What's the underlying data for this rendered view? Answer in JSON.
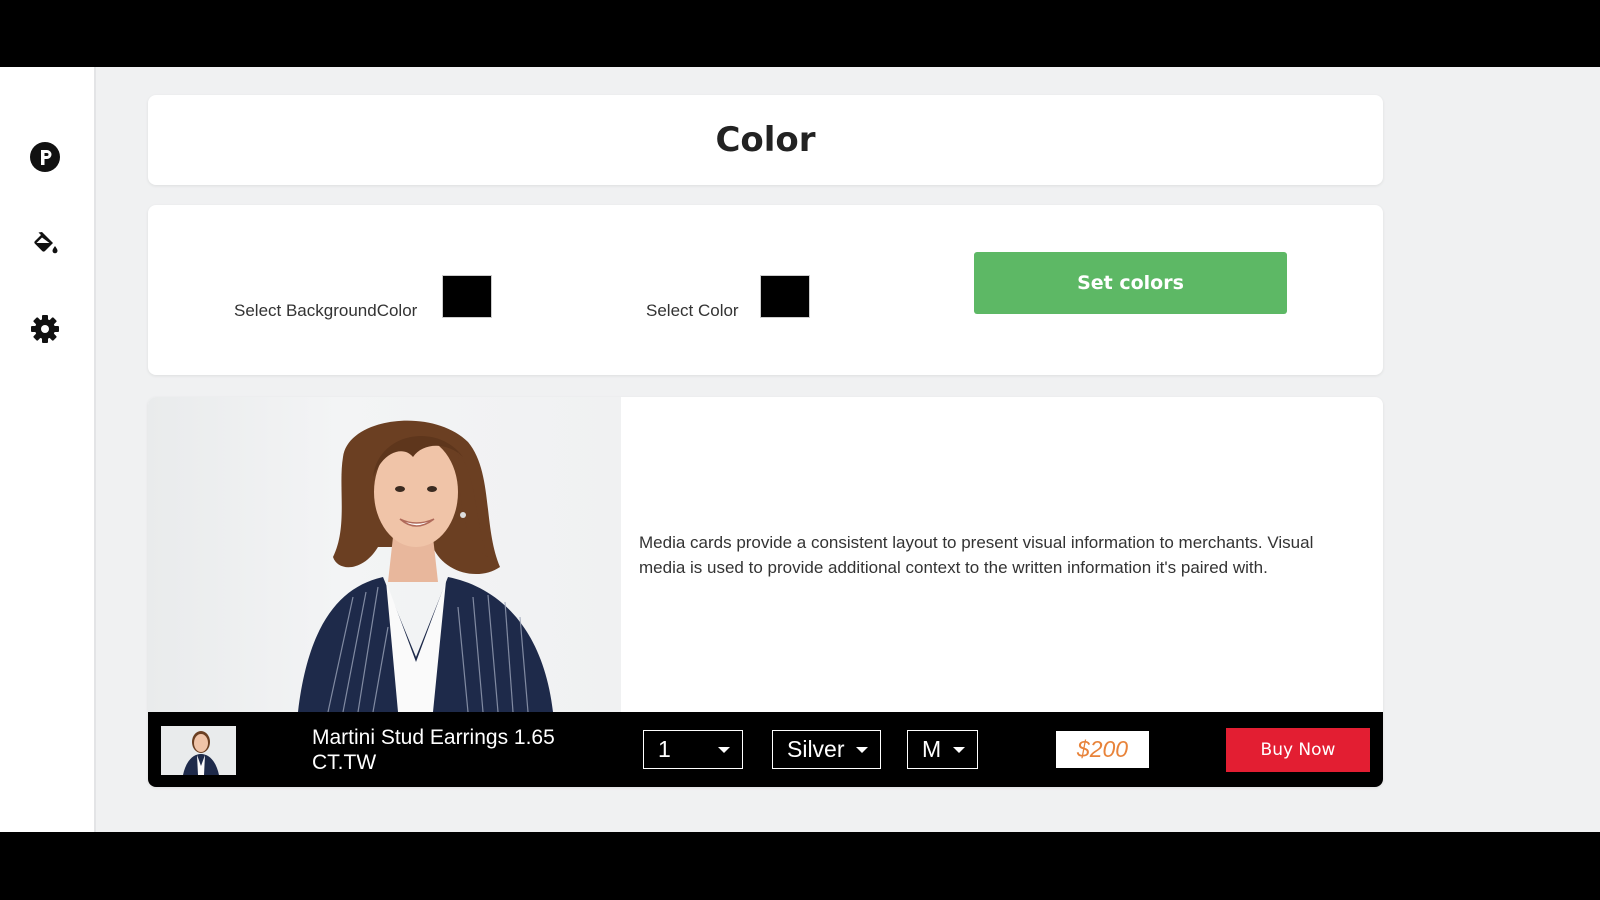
{
  "page": {
    "title": "Color"
  },
  "sidebar": {
    "items": [
      {
        "icon": "p-logo-icon"
      },
      {
        "icon": "paint-bucket-icon"
      },
      {
        "icon": "gear-icon"
      }
    ]
  },
  "settings": {
    "background_label": "Select BackgroundColor",
    "background_value": "#000000",
    "color_label": "Select Color",
    "color_value": "#000000",
    "set_button": "Set colors",
    "button_color": "#5db865"
  },
  "media": {
    "description": "Media cards provide a consistent layout to present visual information to merchants. Visual media is used to provide additional context to the written information it's paired with."
  },
  "buy_bar": {
    "product_name": "Martini Stud Earrings 1.65 CT.TW",
    "quantity": "1",
    "metal": "Silver",
    "size": "M",
    "price": "$200",
    "buy_button": "Buy Now",
    "buy_button_color": "#e31e32",
    "price_color": "#e8833a"
  }
}
